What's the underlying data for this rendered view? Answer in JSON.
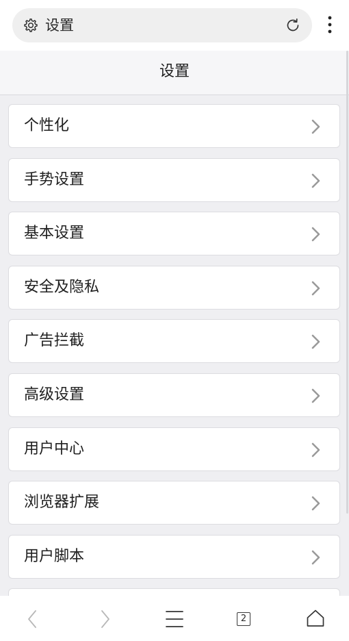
{
  "address_bar": {
    "text": "设置",
    "icon": "gear-icon",
    "reload_icon": "reload-icon"
  },
  "menu_icon": "more-vertical-icon",
  "page": {
    "title": "设置"
  },
  "settings": {
    "items": [
      {
        "label": "个性化"
      },
      {
        "label": "手势设置"
      },
      {
        "label": "基本设置"
      },
      {
        "label": "安全及隐私"
      },
      {
        "label": "广告拦截"
      },
      {
        "label": "高级设置"
      },
      {
        "label": "用户中心"
      },
      {
        "label": "浏览器扩展"
      },
      {
        "label": "用户脚本"
      },
      {
        "label": ""
      }
    ]
  },
  "bottom_nav": {
    "back_icon": "back-icon",
    "forward_icon": "forward-icon",
    "menu_icon": "hamburger-menu-icon",
    "tab_count": "2",
    "home_icon": "home-icon"
  },
  "colors": {
    "background": "#efeff2",
    "card": "#ffffff",
    "chevron": "#9a9a9a",
    "disabled_nav": "#b8b8b8"
  }
}
